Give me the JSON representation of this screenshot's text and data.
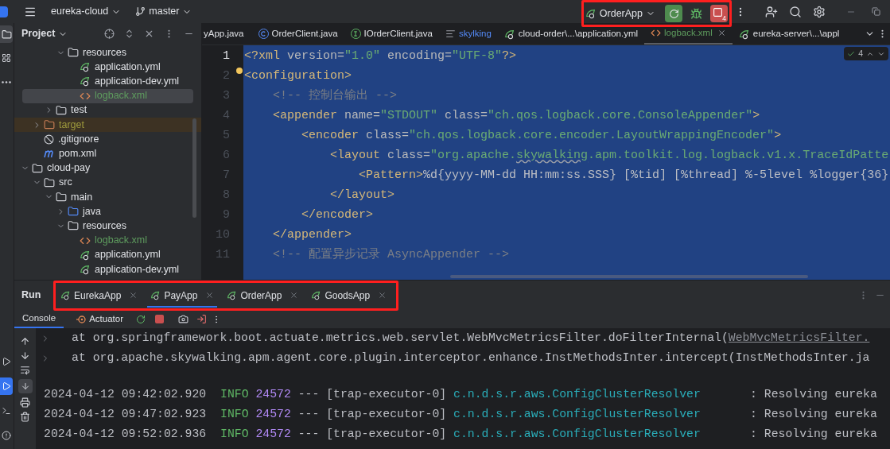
{
  "toolbar": {
    "project": "eureka-cloud",
    "branch": "master",
    "run_config": "OrderApp",
    "stop_count": "4"
  },
  "left_strip": [
    {
      "kind": "folder",
      "selected": true
    },
    {
      "kind": "structure",
      "selected": false
    },
    {
      "kind": "more",
      "selected": false
    }
  ],
  "left_strip_bottom": [
    {
      "kind": "services",
      "selected": false
    },
    {
      "kind": "run",
      "selected": true
    },
    {
      "kind": "terminal",
      "selected": false
    },
    {
      "kind": "problems",
      "selected": false
    }
  ],
  "project_panel": {
    "title": "Project",
    "tree": [
      {
        "children": [
          {
            "children": [
              {
                "children": [
                  {
                    "label": "resources",
                    "kind": "resources",
                    "expanded": true,
                    "selected": false,
                    "color": "#dfe1e5",
                    "children": [
                      {
                        "label": "application.yml",
                        "kind": "yml",
                        "selected": false,
                        "color": "#dfe1e5"
                      },
                      {
                        "label": "application-dev.yml",
                        "kind": "yml",
                        "selected": false,
                        "color": "#dfe1e5"
                      },
                      {
                        "label": "logback.xml",
                        "kind": "xml",
                        "selected": true,
                        "color": "#5e9c5e"
                      }
                    ]
                  }
                ]
              },
              {
                "label": "test",
                "kind": "folder",
                "expanded": false,
                "selected": false,
                "color": "#dfe1e5"
              }
            ]
          },
          {
            "label": "target",
            "kind": "excluded",
            "expanded": false,
            "selected": false,
            "color": "#9e9a3c"
          },
          {
            "label": ".gitignore",
            "kind": "ignore",
            "selected": false,
            "color": "#dfe1e5"
          },
          {
            "label": "pom.xml",
            "kind": "maven",
            "selected": false,
            "color": "#dfe1e5"
          }
        ]
      },
      {
        "label": "cloud-pay",
        "kind": "module",
        "expanded": true,
        "selected": false,
        "color": "#dfe1e5",
        "children": [
          {
            "label": "src",
            "kind": "folder",
            "expanded": true,
            "selected": false,
            "color": "#dfe1e5",
            "children": [
              {
                "label": "main",
                "kind": "folder",
                "expanded": true,
                "selected": false,
                "color": "#dfe1e5",
                "children": [
                  {
                    "label": "java",
                    "kind": "source",
                    "expanded": false,
                    "selected": false,
                    "color": "#dfe1e5"
                  },
                  {
                    "label": "resources",
                    "kind": "resources",
                    "expanded": true,
                    "selected": false,
                    "color": "#dfe1e5",
                    "children": [
                      {
                        "label": "logback.xml",
                        "kind": "xml",
                        "selected": false,
                        "color": "#5e9c5e"
                      },
                      {
                        "label": "application.yml",
                        "kind": "yml",
                        "selected": false,
                        "color": "#dfe1e5"
                      },
                      {
                        "label": "application-dev.yml",
                        "kind": "yml",
                        "selected": false,
                        "color": "#dfe1e5"
                      }
                    ]
                  }
                ]
              }
            ]
          }
        ]
      }
    ]
  },
  "editor_tabs": [
    {
      "label": "yApp.java",
      "kind": "none",
      "selected": false,
      "color": "#dfe1e5"
    },
    {
      "label": "OrderClient.java",
      "kind": "class",
      "selected": false,
      "color": "#dfe1e5"
    },
    {
      "label": "IOrderClient.java",
      "kind": "interface",
      "selected": false,
      "color": "#dfe1e5"
    },
    {
      "label": "skylking",
      "kind": "text",
      "selected": false,
      "color": "#548af7"
    },
    {
      "label": "cloud-order\\...\\application.yml",
      "kind": "yml",
      "selected": false,
      "color": "#dfe1e5"
    },
    {
      "label": "logback.xml",
      "kind": "xml",
      "selected": true,
      "color": "#5e9c5e"
    },
    {
      "label": "eureka-server\\...\\appl",
      "kind": "yml",
      "selected": false,
      "color": "#dfe1e5"
    }
  ],
  "editor": {
    "inspection_count": "4",
    "lines": [
      {
        "number": "1",
        "current": true,
        "segments": [
          {
            "text": "<?xml",
            "kind": "tag"
          },
          {
            "text": " version=",
            "kind": "attr"
          },
          {
            "text": "\"1.0\"",
            "kind": "value"
          },
          {
            "text": " encoding=",
            "kind": "attr"
          },
          {
            "text": "\"UTF-8\"",
            "kind": "value"
          },
          {
            "text": "?>",
            "kind": "tag"
          }
        ]
      },
      {
        "number": "2",
        "current": false,
        "segments": [
          {
            "text": "<configuration>",
            "kind": "tag"
          }
        ]
      },
      {
        "number": "3",
        "current": false,
        "segments": [
          {
            "text": "    <!-- 控制台输出 -->",
            "kind": "comment"
          }
        ]
      },
      {
        "number": "4",
        "current": false,
        "segments": [
          {
            "text": "    <appender",
            "kind": "tag"
          },
          {
            "text": " name=",
            "kind": "attr"
          },
          {
            "text": "\"STDOUT\"",
            "kind": "value"
          },
          {
            "text": " class=",
            "kind": "attr"
          },
          {
            "text": "\"ch.qos.logback.core.ConsoleAppender\"",
            "kind": "value"
          },
          {
            "text": ">",
            "kind": "tag"
          }
        ]
      },
      {
        "number": "5",
        "current": false,
        "segments": [
          {
            "text": "        <encoder",
            "kind": "tag"
          },
          {
            "text": " class=",
            "kind": "attr"
          },
          {
            "text": "\"ch.qos.logback.core.encoder.LayoutWrappingEncoder\"",
            "kind": "value"
          },
          {
            "text": ">",
            "kind": "tag"
          }
        ]
      },
      {
        "number": "6",
        "current": false,
        "segments": [
          {
            "text": "            <layout",
            "kind": "tag"
          },
          {
            "text": " class=",
            "kind": "attr"
          },
          {
            "text": "\"org.apache.",
            "kind": "value"
          },
          {
            "text": "skywalking",
            "kind": "typo"
          },
          {
            "text": ".apm.toolkit.log.logback.v1.x.TraceIdPatte",
            "kind": "value"
          }
        ]
      },
      {
        "number": "7",
        "current": false,
        "segments": [
          {
            "text": "                <Pattern>",
            "kind": "tag"
          },
          {
            "text": "%d{yyyy-MM-dd HH:mm:ss.SSS} [%tid] [%thread] %-5level %logger{36}",
            "kind": "text"
          }
        ]
      },
      {
        "number": "8",
        "current": false,
        "segments": [
          {
            "text": "            </layout>",
            "kind": "tag"
          }
        ]
      },
      {
        "number": "9",
        "current": false,
        "segments": [
          {
            "text": "        </encoder>",
            "kind": "tag"
          }
        ]
      },
      {
        "number": "10",
        "current": false,
        "segments": [
          {
            "text": "    </appender>",
            "kind": "tag"
          }
        ]
      },
      {
        "number": "11",
        "current": false,
        "segments": [
          {
            "text": "    <!-- 配置异步记录 AsyncAppender -->",
            "kind": "comment"
          }
        ]
      }
    ]
  },
  "run_panel": {
    "title": "Run",
    "tabs": [
      {
        "label": "EurekaApp",
        "selected": false
      },
      {
        "label": "PayApp",
        "selected": true
      },
      {
        "label": "OrderApp",
        "selected": false
      },
      {
        "label": "GoodsApp",
        "selected": false
      }
    ],
    "subtabs": [
      {
        "label": "Console",
        "kind": "console",
        "selected": true
      },
      {
        "label": "Actuator",
        "kind": "actuator",
        "selected": false
      }
    ],
    "console": [
      {
        "kind": "stack",
        "segments": [
          {
            "text": "at org.springframework.boot.actuate.metrics.web.servlet.WebMvcMetricsFilter.doFilterInternal(",
            "kind": "plain"
          },
          {
            "text": "WebMvcMetricsFilter.",
            "kind": "link"
          }
        ]
      },
      {
        "kind": "stack",
        "segments": [
          {
            "text": "at org.apache.skywalking.apm.agent.core.plugin.interceptor.enhance.InstMethodsInter.intercept(InstMethodsInter.ja",
            "kind": "plain"
          }
        ]
      },
      {
        "kind": "log",
        "segments": [
          {
            "text": "2024-04-12 09:42:02.920  ",
            "kind": "plain"
          },
          {
            "text": "INFO",
            "kind": "info"
          },
          {
            "text": " 24572",
            "kind": "pid"
          },
          {
            "text": " --- [trap-executor-0] ",
            "kind": "plain"
          },
          {
            "text": "c.n.d.s.r.aws.ConfigClusterResolver",
            "kind": "logger"
          },
          {
            "text": "       : Resolving eureka",
            "kind": "plain"
          }
        ]
      },
      {
        "kind": "log",
        "segments": [
          {
            "text": "2024-04-12 09:47:02.923  ",
            "kind": "plain"
          },
          {
            "text": "INFO",
            "kind": "info"
          },
          {
            "text": " 24572",
            "kind": "pid"
          },
          {
            "text": " --- [trap-executor-0] ",
            "kind": "plain"
          },
          {
            "text": "c.n.d.s.r.aws.ConfigClusterResolver",
            "kind": "logger"
          },
          {
            "text": "       : Resolving eureka",
            "kind": "plain"
          }
        ]
      },
      {
        "kind": "log",
        "segments": [
          {
            "text": "2024-04-12 09:52:02.936  ",
            "kind": "plain"
          },
          {
            "text": "INFO",
            "kind": "info"
          },
          {
            "text": " 24572",
            "kind": "pid"
          },
          {
            "text": " --- [trap-executor-0] ",
            "kind": "plain"
          },
          {
            "text": "c.n.d.s.r.aws.ConfigClusterResolver",
            "kind": "logger"
          },
          {
            "text": "       : Resolving eureka",
            "kind": "plain"
          }
        ]
      }
    ]
  }
}
